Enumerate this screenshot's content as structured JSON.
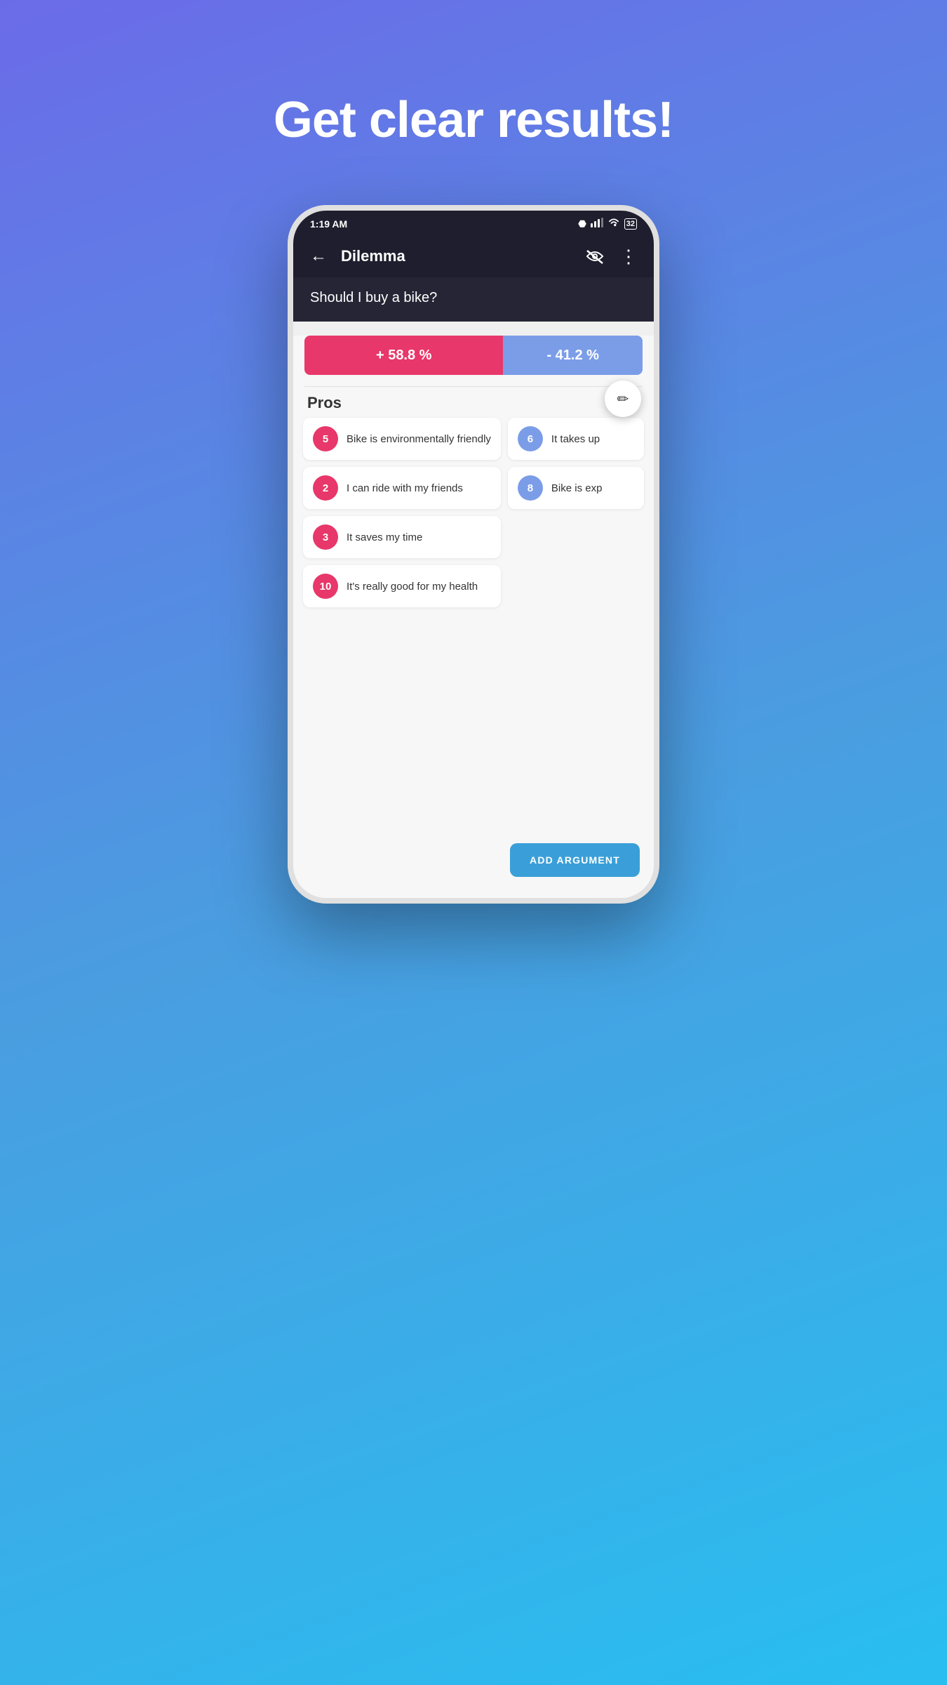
{
  "page": {
    "title": "Get clear results!",
    "background_gradient": "linear-gradient(160deg, #6b6be8 0%, #4a9de0 50%, #29bef0 100%)"
  },
  "status_bar": {
    "time": "1:19 AM",
    "notification_icon": "🔔",
    "bluetooth": "B",
    "signal": "▲▲▲",
    "wifi": "WiFi",
    "battery": "32"
  },
  "app_bar": {
    "back_label": "←",
    "title": "Dilemma",
    "hide_icon": "👁",
    "more_icon": "⋮"
  },
  "question": {
    "text": "Should I buy a bike?"
  },
  "scores": {
    "pros_percent": "+ 58.8 %",
    "cons_percent": "- 41.2 %",
    "pros_flex": 58.8,
    "cons_flex": 41.2
  },
  "pros_section": {
    "label": "Pros",
    "items": [
      {
        "id": 1,
        "badge": "5",
        "badge_type": "pink",
        "text": "Bike is environmentally friendly",
        "col": "left"
      },
      {
        "id": 2,
        "badge": "6",
        "badge_type": "blue",
        "text": "It takes up",
        "col": "right"
      },
      {
        "id": 3,
        "badge": "2",
        "badge_type": "pink",
        "text": "I can ride with my friends",
        "col": "left"
      },
      {
        "id": 4,
        "badge": "8",
        "badge_type": "blue",
        "text": "Bike is exp",
        "col": "right"
      },
      {
        "id": 5,
        "badge": "3",
        "badge_type": "pink",
        "text": "It saves my time",
        "col": "left"
      },
      {
        "id": 6,
        "badge": "10",
        "badge_type": "pink",
        "text": "It's really good for my health",
        "col": "left"
      }
    ]
  },
  "add_button": {
    "label": "ADD ARGUMENT"
  },
  "edit_button": {
    "icon": "✏"
  }
}
